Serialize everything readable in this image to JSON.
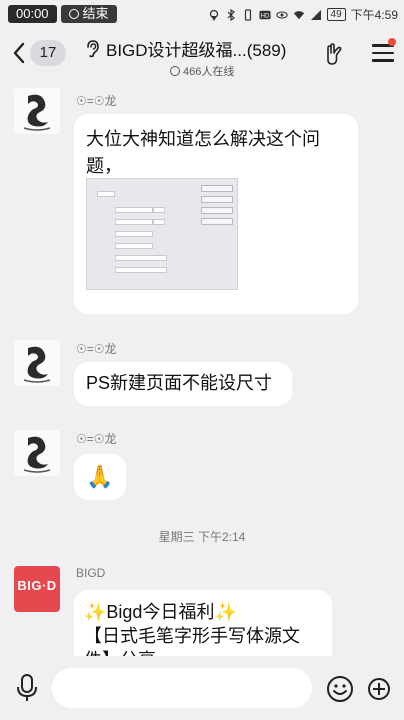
{
  "status_bar": {
    "time": "00:00",
    "end_label": "结束",
    "battery": "49",
    "clock": "下午4:59"
  },
  "header": {
    "back_count": "17",
    "title": "BIGD设计超级福...(589)",
    "online": "466人在线"
  },
  "messages": [
    {
      "sender": "☉=☉龙",
      "text_lines": [
        "大位大神知道怎么解决这个问",
        "题，"
      ],
      "has_image": true
    },
    {
      "sender": "☉=☉龙",
      "text": "PS新建页面不能设尺寸"
    },
    {
      "sender": "☉=☉龙",
      "emoji": "🙏"
    },
    {
      "sender": "BIGD",
      "text_lines": [
        "✨Bigd今日福利✨",
        "【日式毛笔字形手写体源文",
        "件】分享"
      ]
    }
  ],
  "timestamp": "星期三 下午2:14",
  "bigd_logo_text": "BIG·D",
  "input": {
    "placeholder": ""
  },
  "colors": {
    "background": "#f0f0f3",
    "bubble": "#ffffff",
    "bigd_red": "#e5484d",
    "notif_dot": "#f04a3a"
  }
}
